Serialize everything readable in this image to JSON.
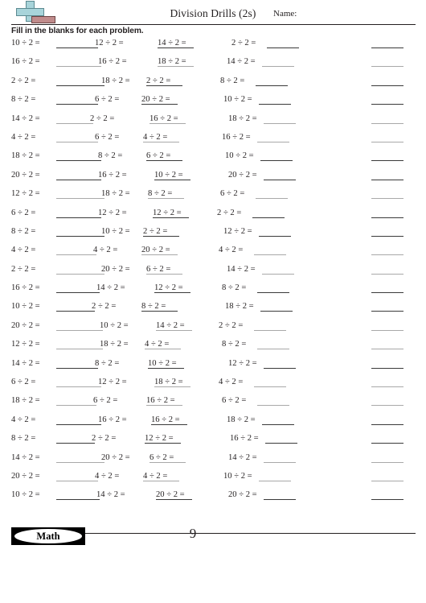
{
  "document": {
    "title": "Division Drills (2s)",
    "name_label": "Name:",
    "instructions": "Fill in the blanks for each problem.",
    "logo_icon": "plus-bar-logo-icon"
  },
  "footer": {
    "subject": "Math",
    "page_number": "9"
  },
  "worksheet": {
    "columns": 5,
    "answer_blank_columns": [
      1,
      2,
      3,
      4,
      5
    ],
    "rows": [
      {
        "c1": "10 ÷ 2 =",
        "c2": "12 ÷ 2 =",
        "c3": "14 ÷ 2 =",
        "c4": "2 ÷ 2 ="
      },
      {
        "c1": "16 ÷ 2 =",
        "c2": "16 ÷ 2 =",
        "c3": "18 ÷ 2 =",
        "c4": "14 ÷ 2 ="
      },
      {
        "c1": "2 ÷ 2 =",
        "c2": "18 ÷ 2 =",
        "c3": "2 ÷ 2 =",
        "c4": "8 ÷ 2 ="
      },
      {
        "c1": "8 ÷ 2 =",
        "c2": "6 ÷ 2 =",
        "c3": "20 ÷ 2 =",
        "c4": "10 ÷ 2 ="
      },
      {
        "c1": "14 ÷ 2 =",
        "c2": "2 ÷ 2 =",
        "c3": "16 ÷ 2 =",
        "c4": "18 ÷ 2 ="
      },
      {
        "c1": "4 ÷ 2 =",
        "c2": "6 ÷ 2 =",
        "c3": "4 ÷ 2 =",
        "c4": "16 ÷ 2 ="
      },
      {
        "c1": "18 ÷ 2 =",
        "c2": "8 ÷ 2 =",
        "c3": "6 ÷ 2 =",
        "c4": "10 ÷ 2 ="
      },
      {
        "c1": "20 ÷ 2 =",
        "c2": "16 ÷ 2 =",
        "c3": "10 ÷ 2 =",
        "c4": "20 ÷ 2 ="
      },
      {
        "c1": "12 ÷ 2 =",
        "c2": "18 ÷ 2 =",
        "c3": "8 ÷ 2 =",
        "c4": "6 ÷ 2 ="
      },
      {
        "c1": "6 ÷ 2 =",
        "c2": "12 ÷ 2 =",
        "c3": "12 ÷ 2 =",
        "c4": "2 ÷ 2 ="
      },
      {
        "c1": "8 ÷ 2 =",
        "c2": "10 ÷ 2 =",
        "c3": "2 ÷ 2 =",
        "c4": "12 ÷ 2 ="
      },
      {
        "c1": "4 ÷ 2 =",
        "c2": "4 ÷ 2 =",
        "c3": "20 ÷ 2 =",
        "c4": "4 ÷ 2 ="
      },
      {
        "c1": "2 ÷ 2 =",
        "c2": "20 ÷ 2 =",
        "c3": "6 ÷ 2 =",
        "c4": "14 ÷ 2 ="
      },
      {
        "c1": "16 ÷ 2 =",
        "c2": "14 ÷ 2 =",
        "c3": "12 ÷ 2 =",
        "c4": "8 ÷ 2 ="
      },
      {
        "c1": "10 ÷ 2 =",
        "c2": "2 ÷ 2 =",
        "c3": "8 ÷ 2 =",
        "c4": "18 ÷ 2 ="
      },
      {
        "c1": "20 ÷ 2 =",
        "c2": "10 ÷ 2 =",
        "c3": "14 ÷ 2 =",
        "c4": "2 ÷ 2 ="
      },
      {
        "c1": "12 ÷ 2 =",
        "c2": "18 ÷ 2 =",
        "c3": "4 ÷ 2 =",
        "c4": "8 ÷ 2 ="
      },
      {
        "c1": "14 ÷ 2 =",
        "c2": "8 ÷ 2 =",
        "c3": "10 ÷ 2 =",
        "c4": "12 ÷ 2 ="
      },
      {
        "c1": "6 ÷ 2 =",
        "c2": "12 ÷ 2 =",
        "c3": "18 ÷ 2 =",
        "c4": "4 ÷ 2 ="
      },
      {
        "c1": "18 ÷ 2 =",
        "c2": "6 ÷ 2 =",
        "c3": "16 ÷ 2 =",
        "c4": "6 ÷ 2 ="
      },
      {
        "c1": "4 ÷ 2 =",
        "c2": "16 ÷ 2 =",
        "c3": "16 ÷ 2 =",
        "c4": "18 ÷ 2 ="
      },
      {
        "c1": "8 ÷ 2 =",
        "c2": "2 ÷ 2 =",
        "c3": "12 ÷ 2 =",
        "c4": "16 ÷ 2 ="
      },
      {
        "c1": "14 ÷ 2 =",
        "c2": "20 ÷ 2 =",
        "c3": "6 ÷ 2 =",
        "c4": "14 ÷ 2 ="
      },
      {
        "c1": "20 ÷ 2 =",
        "c2": "4 ÷ 2 =",
        "c3": "4 ÷ 2 =",
        "c4": "10 ÷ 2 ="
      },
      {
        "c1": "10 ÷ 2 =",
        "c2": "14 ÷ 2 =",
        "c3": "20 ÷ 2 =",
        "c4": "20 ÷ 2 ="
      }
    ]
  }
}
